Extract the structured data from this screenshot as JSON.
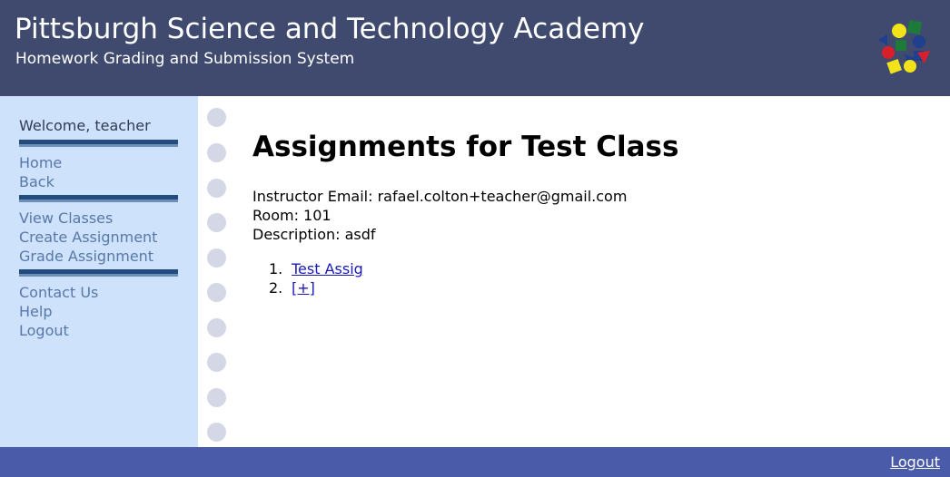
{
  "header": {
    "title": "Pittsburgh Science and Technology Academy",
    "subtitle": "Homework Grading and Submission System",
    "logo_icon": "colored-shapes-logo-icon"
  },
  "sidebar": {
    "welcome": "Welcome, teacher",
    "groups": [
      [
        "Home",
        "Back"
      ],
      [
        "View Classes",
        "Create Assignment",
        "Grade Assignment"
      ],
      [
        "Contact Us",
        "Help",
        "Logout"
      ]
    ]
  },
  "main": {
    "title": "Assignments for Test Class",
    "instructor_email_label": "Instructor Email:",
    "instructor_email": "rafael.colton+teacher@gmail.com",
    "room_label": "Room:",
    "room": "101",
    "description_label": "Description:",
    "description": "asdf",
    "assignments": [
      {
        "number": "1.",
        "label": "Test Assig"
      },
      {
        "number": "2.",
        "label": "[+]"
      }
    ]
  },
  "footer": {
    "logout": "Logout"
  },
  "colors": {
    "header_bg": "#3f4a6e",
    "sidebar_bg": "#cfe2fb",
    "sidebar_link": "#5878a8",
    "footer_bg": "#4a5baa",
    "link": "#1a1ab8"
  }
}
